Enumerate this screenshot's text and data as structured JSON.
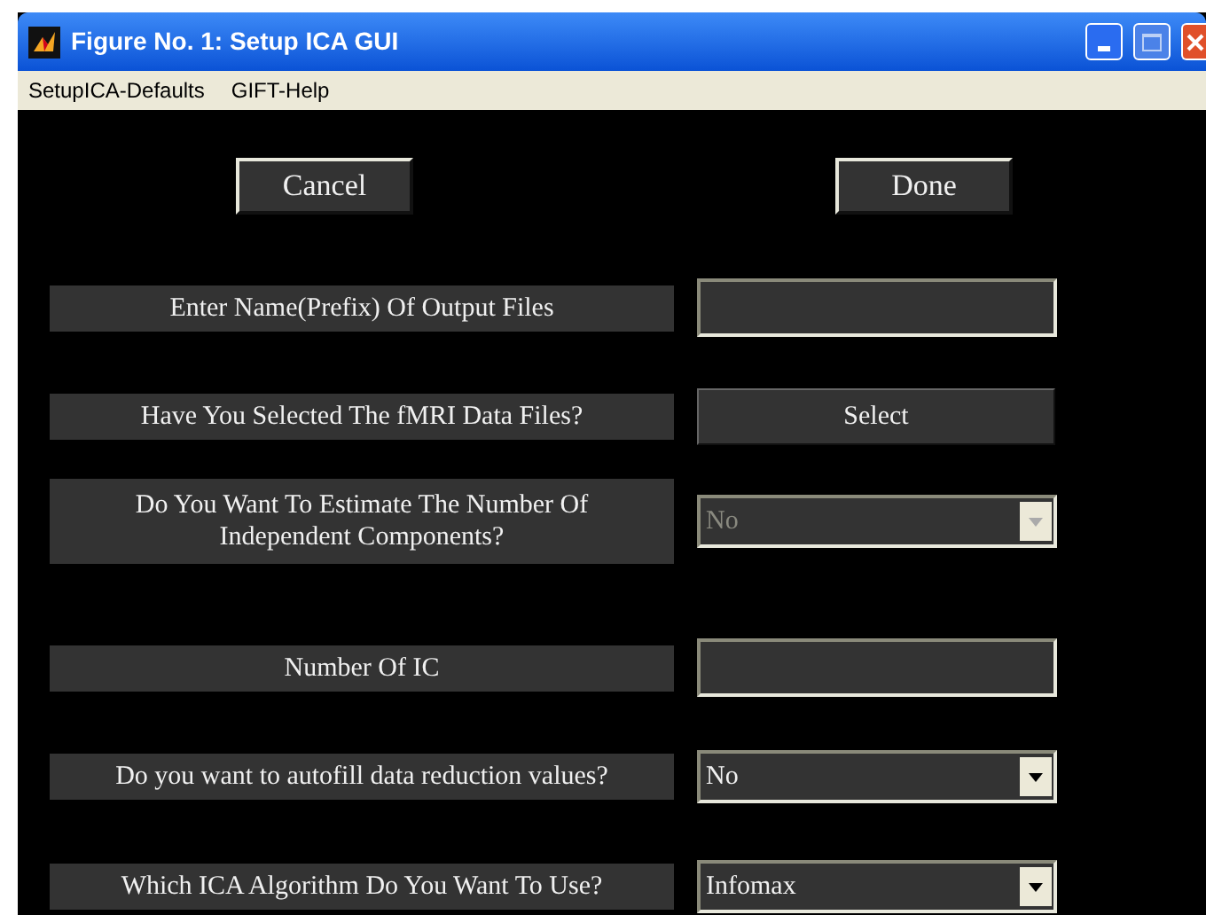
{
  "window": {
    "title": "Figure No. 1: Setup ICA GUI"
  },
  "menu": [
    "SetupICA-Defaults",
    "GIFT-Help"
  ],
  "buttons": [
    "Cancel",
    "Done"
  ],
  "rows": [
    {
      "label": "Enter Name(Prefix) Of Output Files",
      "kind": "field"
    },
    {
      "label": "Have You Selected The fMRI Data Files?",
      "kind": "button",
      "value": "Select"
    },
    {
      "label": "Do You Want To Estimate The Number Of Independent Components?",
      "kind": "dropdown",
      "value": "No",
      "disabled": true
    },
    {
      "label": "Number Of IC",
      "kind": "field"
    },
    {
      "label": "Do you want to autofill data reduction values?",
      "kind": "dropdown",
      "value": "No",
      "disabled": false
    },
    {
      "label": "Which ICA Algorithm Do You Want To Use?",
      "kind": "dropdown",
      "value": "Infomax",
      "disabled": false
    }
  ]
}
